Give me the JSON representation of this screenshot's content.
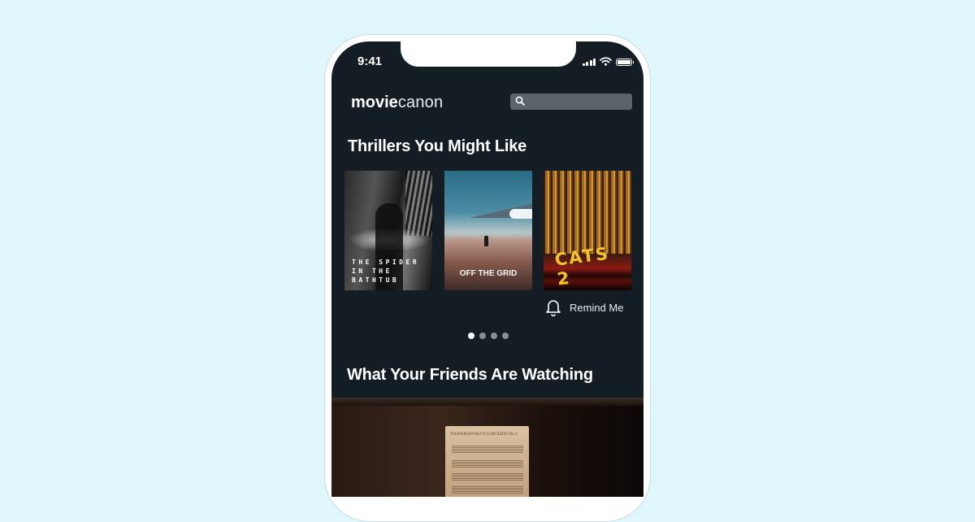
{
  "status_bar": {
    "time": "9:41",
    "icons": [
      "signal-icon",
      "wifi-icon",
      "battery-icon"
    ]
  },
  "header": {
    "logo_bold": "movie",
    "logo_light": "canon",
    "search": {
      "placeholder": "",
      "value": "",
      "icon": "search-icon"
    }
  },
  "sections": {
    "thrillers": {
      "title": "Thrillers You Might Like",
      "posters": [
        {
          "title": "THE SPIDER IN THE BATHTUB",
          "line1": "THE SPIDER",
          "line2": "IN THE",
          "line3": "BATHTUB"
        },
        {
          "title": "OFF THE GRID"
        },
        {
          "title": "CATS 2"
        }
      ],
      "remind": {
        "label": "Remind Me",
        "icon": "bell-icon"
      },
      "pagination": {
        "total": 4,
        "active": 1
      }
    },
    "friends": {
      "title": "What Your Friends Are Watching",
      "feature_sheet_title": "TSCHAIKOWSKY'S CONCERTO No.1"
    }
  },
  "colors": {
    "background": "#dff6fb",
    "screen": "#141c24",
    "search": "#5b636b",
    "accent_yellow": "#f2c230"
  }
}
